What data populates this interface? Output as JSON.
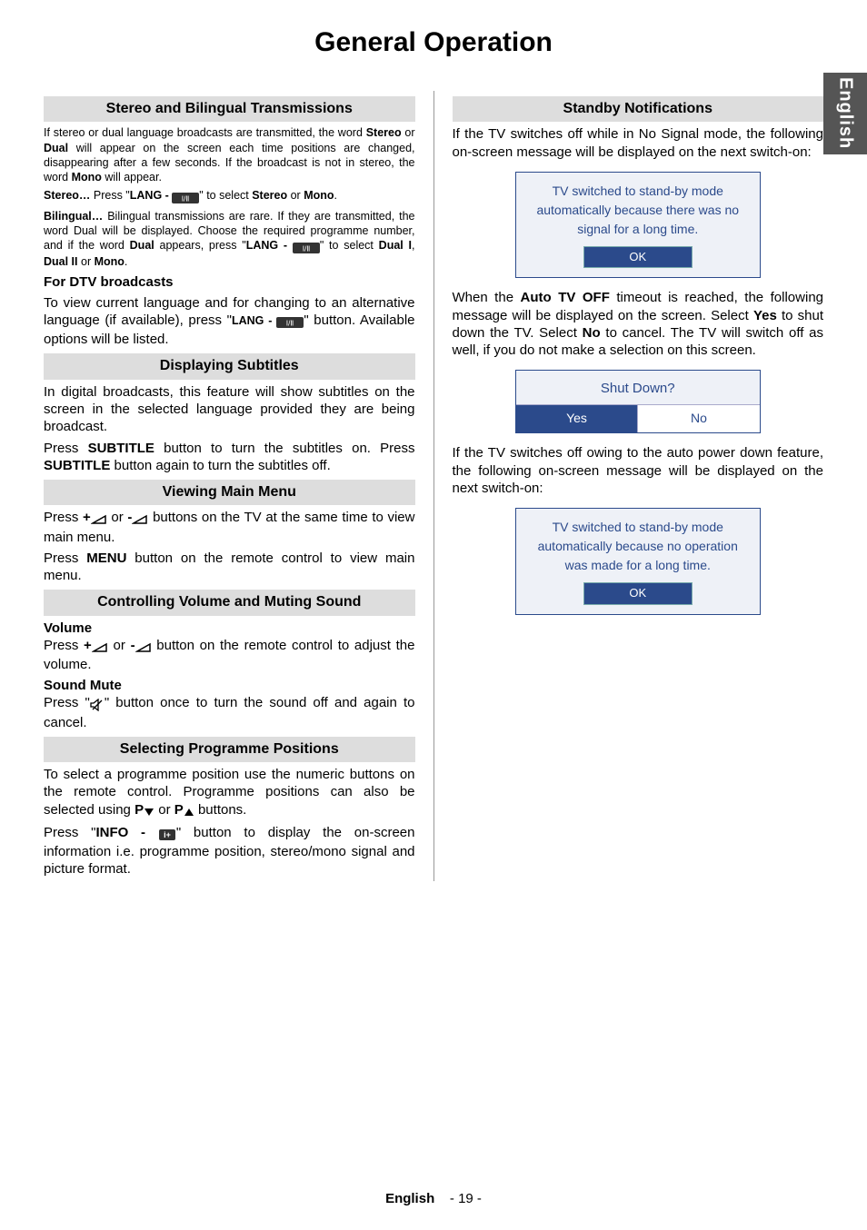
{
  "page_title": "General Operation",
  "side_tab": "English",
  "footer_lang": "English",
  "footer_page": "- 19 -",
  "left": {
    "stereo_header": "Stereo and Bilingual Transmissions",
    "stereo_p1a": "If stereo or dual language broadcasts are transmitted, the word ",
    "stereo_p1_b1": "Stereo",
    "stereo_p1b": " or ",
    "stereo_p1_b2": "Dual",
    "stereo_p1c": " will appear on the screen each time positions are changed, disappearing after a few seconds. If the broadcast is not in stereo, the word ",
    "stereo_p1_b3": "Mono",
    "stereo_p1d": " will appear.",
    "stereo_line2_a": "Stereo…",
    "stereo_line2_b": " Press \"",
    "stereo_line2_c": "LANG - ",
    "stereo_line2_d": "\" to select ",
    "stereo_line2_e": "Stereo",
    "stereo_line2_f": " or ",
    "stereo_line2_g": "Mono",
    "stereo_line2_h": ".",
    "biling_a": "Bilingual…",
    "biling_b": " Bilingual transmissions are rare. If they are transmitted, the word Dual will be displayed. Choose the required programme number, and if the word ",
    "biling_c": "Dual",
    "biling_d": " appears, press \"",
    "biling_e": "LANG - ",
    "biling_f": "\" to select ",
    "biling_g": "Dual I",
    "biling_h": ", ",
    "biling_i": "Dual II",
    "biling_j": " or ",
    "biling_k": "Mono",
    "biling_l": ".",
    "dtv_header": "For DTV broadcasts",
    "dtv_p_a": "To view current language and for changing to an alternative language (if available), press \"",
    "dtv_p_b": "LANG - ",
    "dtv_p_c": "\" button. Available options will be listed.",
    "subs_header": "Displaying Subtitles",
    "subs_p1": "In digital broadcasts, this feature will show subtitles on the screen in the selected language provided they are being broadcast.",
    "subs_p2_a": "Press ",
    "subs_p2_b": "SUBTITLE",
    "subs_p2_c": " button to turn the subtitles on. Press ",
    "subs_p2_d": "SUBTITLE",
    "subs_p2_e": " button again to turn the subtitles off.",
    "view_main_header": "Viewing Main Menu",
    "view_main_p1_a": "Press ",
    "view_main_p1_b": "+",
    "view_main_p1_c": " or ",
    "view_main_p1_d": "-",
    "view_main_p1_e": " buttons on the TV at the same time to view main menu.",
    "view_main_p2_a": "Press ",
    "view_main_p2_b": "MENU",
    "view_main_p2_c": " button on the remote control to view main menu.",
    "volmute_header": "Controlling Volume and Muting Sound",
    "vol_label": "Volume",
    "vol_p_a": "Press ",
    "vol_p_b": "+",
    "vol_p_c": " or ",
    "vol_p_d": "-",
    "vol_p_e": " button on the remote control to adjust the volume.",
    "mute_label": "Sound Mute",
    "mute_p_a": "Press \"",
    "mute_p_b": "\" button once to turn the sound off and again to cancel.",
    "selprog_header": "Selecting Programme Positions",
    "selprog_p1_a": "To select a programme position use the numeric buttons on the remote control. Programme positions can also be selected using ",
    "selprog_p1_b": "P",
    "selprog_p1_c": " or ",
    "selprog_p1_d": "P",
    "selprog_p1_e": " buttons.",
    "selprog_p2_a": "Press \"",
    "selprog_p2_b": "INFO - ",
    "selprog_p2_c": "\" button to display the on-screen information i.e. programme position, stereo/mono signal and picture format."
  },
  "right": {
    "standby_header": "Standby Notifications",
    "standby_p1": "If the TV switches off while in No Signal mode, the following on-screen message will be displayed on the next switch-on:",
    "osd1_line1": "TV switched to stand-by mode",
    "osd1_line2": "automatically because there was no",
    "osd1_line3": "signal for a long time.",
    "osd_ok": "OK",
    "standby_p2_a": "When the ",
    "standby_p2_b": "Auto TV OFF",
    "standby_p2_c": " timeout is reached, the following message will be displayed on the screen. Select ",
    "standby_p2_d": "Yes",
    "standby_p2_e": " to shut down the TV. Select ",
    "standby_p2_f": "No",
    "standby_p2_g": " to cancel. The TV will switch off as well, if you do not make a selection on this screen.",
    "osd2_q": "Shut Down?",
    "osd2_yes": "Yes",
    "osd2_no": "No",
    "standby_p3": "If the TV switches off owing to the auto power down feature, the following on-screen message will be displayed on the next switch-on:",
    "osd3_line1": "TV switched to stand-by mode",
    "osd3_line2": "automatically because no operation",
    "osd3_line3": "was made for a long time."
  }
}
